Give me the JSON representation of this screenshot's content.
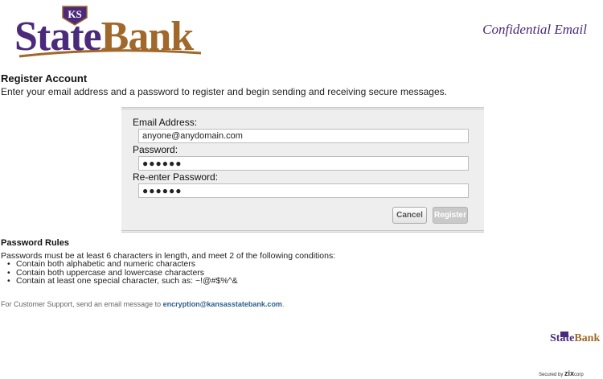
{
  "header": {
    "logo_state": "State",
    "logo_bank": "Bank",
    "logo_badge": "KS",
    "confidential_title": "Confidential Email"
  },
  "page": {
    "heading": "Register Account",
    "intro": "Enter your email address and a password to register and begin sending and receiving secure messages."
  },
  "form": {
    "email_label": "Email Address:",
    "email_value": "anyone@anydomain.com",
    "password_label": "Password:",
    "password_value": "●●●●●●",
    "reenter_label": "Re-enter Password:",
    "reenter_value": "●●●●●●",
    "cancel_label": "Cancel",
    "register_label": "Register"
  },
  "rules": {
    "heading": "Password Rules",
    "intro": "Passwords must be at least 6 characters in length, and meet 2 of the following conditions:",
    "items": [
      "Contain both alphabetic and numeric characters",
      "Contain both uppercase and lowercase characters",
      "Contain at least one special character, such as: ~!@#$%^&"
    ]
  },
  "support": {
    "text": "For Customer Support, send an email message to ",
    "email": "encryption@kansasstatebank.com",
    "period": "."
  },
  "footer": {
    "logo_state": "State",
    "logo_bank": "Bank",
    "secured_by": "Secured by",
    "zix": "zix",
    "corp": "corp"
  },
  "colors": {
    "brand_purple": "#4b2a7b",
    "brand_gold": "#a0682a",
    "link_blue": "#2c5f8a"
  }
}
